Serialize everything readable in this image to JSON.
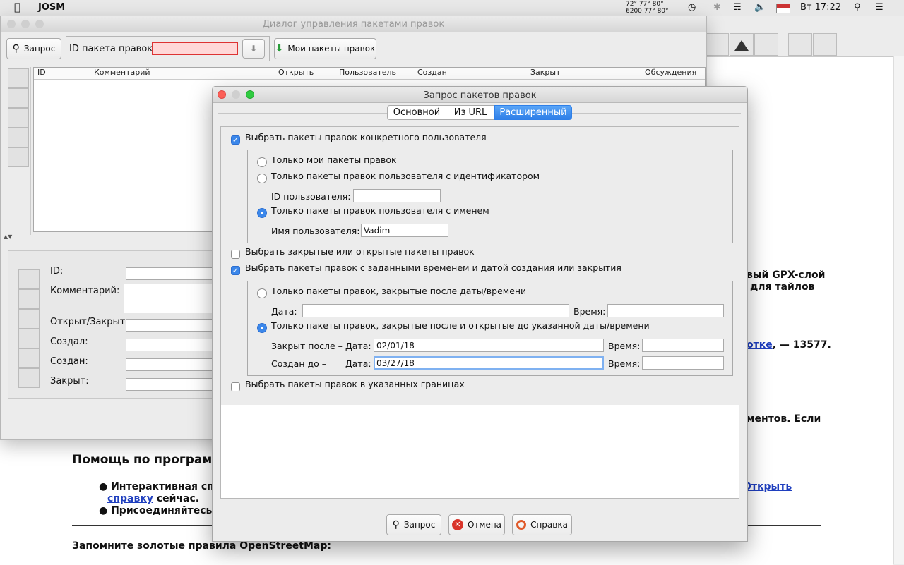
{
  "menubar": {
    "app_name": "JOSM",
    "status_temp_top": "72°  77° 80°",
    "status_temp_bottom": "6200 77° 80°",
    "clock": "Вт 17:22"
  },
  "background": {
    "line_gpx": "вый GPX-слой",
    "line_tiles": "для тайлов",
    "line_link": "отке",
    "line_count": ", — 13577.",
    "line_elements": "ментов. Если",
    "heading": "Помощь по программ",
    "bullet1_start": "Интерактивная спра",
    "bullet1_link_open": "Открыть",
    "bullet1_link": "справку",
    "bullet1_end": " сейчас.",
    "bullet2_start": "Присоединяйтесь к ",
    "footer": "Запомните золотые правила OpenStreetMap:"
  },
  "back_dialog": {
    "title": "Диалог управления пакетами правок",
    "query_button": "Запрос",
    "id_label": "ID пакета правок:",
    "my_changesets_button": "Мои пакеты правок",
    "columns": [
      "ID",
      "Комментарий",
      "Открыть",
      "Пользователь",
      "Создан",
      "Закрыт",
      "Обсуждения"
    ],
    "detail_labels": {
      "id": "ID:",
      "comment": "Комментарий:",
      "open_closed": "Открыт/Закрыт:",
      "created_by": "Создал:",
      "created": "Создан:",
      "closed": "Закрыт:"
    }
  },
  "front_dialog": {
    "title": "Запрос пакетов правок",
    "tabs": [
      "Основной",
      "Из URL",
      "Расширенный"
    ],
    "selected_tab": "Расширенный",
    "user_section": {
      "checkbox_label": "Выбрать пакеты правок конкретного пользователя",
      "checked": true,
      "radio_mine": "Только мои пакеты правок",
      "radio_by_id": "Только пакеты правок пользователя с идентификатором",
      "user_id_label": "ID пользователя:",
      "user_id_value": "",
      "radio_by_name": "Только пакеты правок пользователя с именем",
      "username_label": "Имя пользователя:",
      "username_value": "Vadim"
    },
    "open_closed_checkbox": "Выбрать закрытые или открытые пакеты правок",
    "time_section": {
      "checkbox_label": "Выбрать пакеты правок с заданными временем и датой создания или закрытия",
      "checked": true,
      "radio_closed_after": "Только пакеты правок, закрытые после даты/времени",
      "date_label": "Дата:",
      "time_label": "Время:",
      "radio_closed_created": "Только пакеты правок, закрытые после и открытые до указанной даты/времени",
      "closed_after_label": "Закрыт после –",
      "closed_after_date": "02/01/18",
      "created_before_label": "Создан до –",
      "created_before_date": "03/27/18"
    },
    "bounds_checkbox": "Выбрать пакеты правок в указанных границах",
    "buttons": {
      "query": "Запрос",
      "cancel": "Отмена",
      "help": "Справка"
    }
  },
  "colors": {
    "accent": "#3b87ea",
    "invalid_field": "#ffd8d8",
    "link": "#1f3fbf"
  }
}
